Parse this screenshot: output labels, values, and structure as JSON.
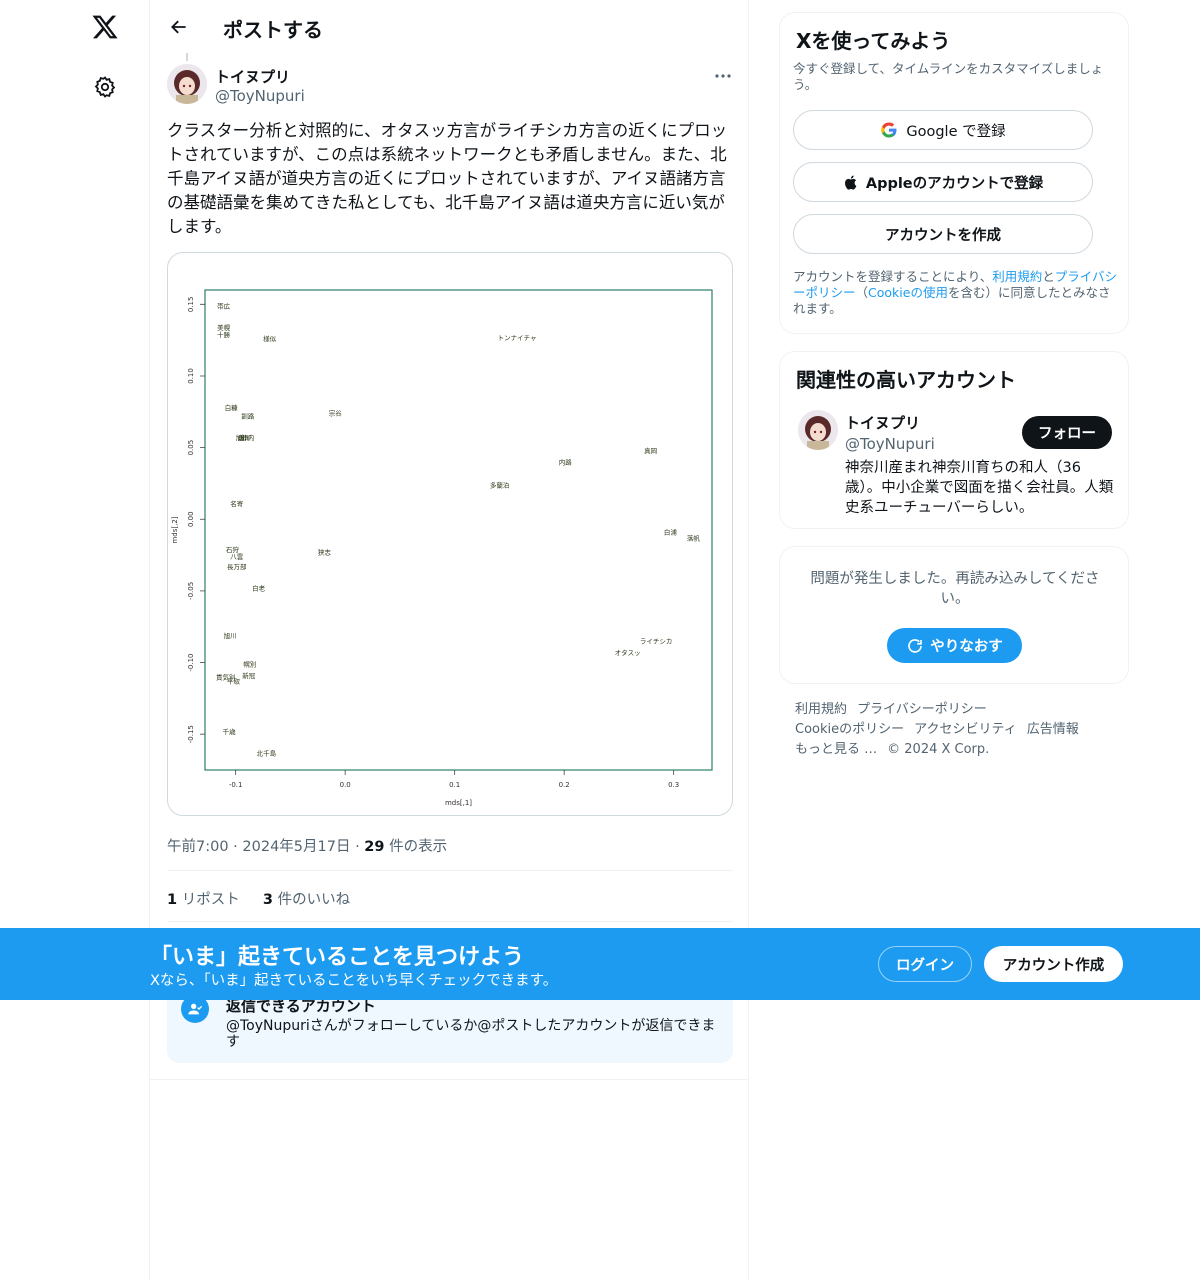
{
  "nav": {
    "logo_icon": "x-logo-icon",
    "settings_icon": "gear-icon"
  },
  "header": {
    "title": "ポストする",
    "back_icon": "arrow-left-icon"
  },
  "post": {
    "author_name": "トイヌプリ",
    "author_handle": "@ToyNupuri",
    "text": "クラスター分析と対照的に、オタスッ方言がライチシカ方言の近くにプロットされていますが、この点は系統ネットワークとも矛盾しません。また、北千島アイヌ語が道央方言の近くにプロットされていますが、アイヌ語諸方言の基礎語彙を集めてきた私としても、北千島アイヌ語は道央方言に近い気がします。",
    "time": "午前7:00",
    "date": "2024年5月17日",
    "view_count": "29",
    "view_label": "件の表示",
    "repost_count": "1",
    "repost_label": "リポスト",
    "like_count": "3",
    "like_label": "件のいいね"
  },
  "reply_restriction": {
    "title": "返信できるアカウント",
    "description": "@ToyNupuriさんがフォローしているか@ポストしたアカウントが返信できます"
  },
  "signup_card": {
    "title": "Xを使ってみよう",
    "subtitle": "今すぐ登録して、タイムラインをカスタマイズしましょう。",
    "google_label": "Google で登録",
    "apple_label": "Appleのアカウントで登録",
    "create_label": "アカウントを作成",
    "terms_prefix": "アカウントを登録することにより、",
    "terms_link": "利用規約",
    "terms_and": "と",
    "privacy_link": "プライバシーポリシー",
    "terms_paren_open": "（",
    "cookie_link": "Cookieの使用",
    "terms_suffix": "を含む）に同意したとみなされます。"
  },
  "related": {
    "title": "関連性の高いアカウント",
    "name": "トイヌプリ",
    "handle": "@ToyNupuri",
    "follow_label": "フォロー",
    "bio": "神奈川産まれ神奈川育ちの和人（36歳）。中小企業で図面を描く会社員。人類史系ユーチューバーらしい。"
  },
  "error_card": {
    "message": "問題が発生しました。再読み込みしてください。",
    "retry_label": "やりなおす"
  },
  "footer": {
    "links": [
      "利用規約",
      "プライバシーポリシー",
      "Cookieのポリシー",
      "アクセシビリティ",
      "広告情報",
      "もっと見る …"
    ],
    "copyright": "© 2024 X Corp."
  },
  "banner": {
    "title": "「いま」起きていることを見つけよう",
    "subtitle": "Xなら、「いま」起きていることをいち早くチェックできます。",
    "login_label": "ログイン",
    "signup_label": "アカウント作成"
  },
  "colors": {
    "accent": "#1d9bf0",
    "text": "#0f1419",
    "secondary": "#536471",
    "border": "#eff3f4",
    "chart_frame": "#2e7d6b",
    "chart_label": "#2d3a1a"
  },
  "chart_data": {
    "type": "scatter",
    "title": "",
    "xlabel": "mds[,1]",
    "ylabel": "mds[,2]",
    "xlim": [
      -0.128,
      0.335
    ],
    "ylim": [
      -0.175,
      0.16
    ],
    "xticks": [
      -0.1,
      0.0,
      0.1,
      0.2,
      0.3
    ],
    "xtick_labels": [
      "-0.1",
      "0.0",
      "0.1",
      "0.2",
      "0.3"
    ],
    "yticks": [
      -0.15,
      -0.1,
      -0.05,
      0.0,
      0.05,
      0.1,
      0.15
    ],
    "ytick_labels": [
      "-0.15",
      "-0.10",
      "-0.05",
      "0.00",
      "0.05",
      "0.10",
      "0.15"
    ],
    "points": [
      {
        "label": "帯広",
        "x": -0.111,
        "y": 0.149
      },
      {
        "label": "美幌",
        "x": -0.111,
        "y": 0.134
      },
      {
        "label": "十勝",
        "x": -0.111,
        "y": 0.129
      },
      {
        "label": "様似",
        "x": -0.069,
        "y": 0.126
      },
      {
        "label": "トンナイチャ",
        "x": 0.157,
        "y": 0.127
      },
      {
        "label": "白糠",
        "x": -0.104,
        "y": 0.078
      },
      {
        "label": "釧路",
        "x": -0.089,
        "y": 0.072
      },
      {
        "label": "宗谷",
        "x": -0.009,
        "y": 0.074
      },
      {
        "label": "旭川",
        "x": -0.094,
        "y": 0.057
      },
      {
        "label": "静内",
        "x": -0.089,
        "y": 0.057
      },
      {
        "label": "鵡川",
        "x": -0.092,
        "y": 0.057
      },
      {
        "label": "真岡",
        "x": 0.279,
        "y": 0.048
      },
      {
        "label": "内路",
        "x": 0.201,
        "y": 0.04
      },
      {
        "label": "多蘭泊",
        "x": 0.141,
        "y": 0.024
      },
      {
        "label": "名寄",
        "x": -0.099,
        "y": 0.011
      },
      {
        "label": "白浦",
        "x": 0.297,
        "y": -0.009
      },
      {
        "label": "落帆",
        "x": 0.318,
        "y": -0.013
      },
      {
        "label": "石狩",
        "x": -0.103,
        "y": -0.021
      },
      {
        "label": "八雲",
        "x": -0.099,
        "y": -0.026
      },
      {
        "label": "長万部",
        "x": -0.099,
        "y": -0.033
      },
      {
        "label": "狭志",
        "x": -0.019,
        "y": -0.023
      },
      {
        "label": "白老",
        "x": -0.079,
        "y": -0.048
      },
      {
        "label": "旭川",
        "x": -0.105,
        "y": -0.081
      },
      {
        "label": "ライチシカ",
        "x": 0.284,
        "y": -0.085
      },
      {
        "label": "オタスッ",
        "x": 0.258,
        "y": -0.093
      },
      {
        "label": "幌別",
        "x": -0.087,
        "y": -0.101
      },
      {
        "label": "新冠",
        "x": -0.088,
        "y": -0.109
      },
      {
        "label": "貫気別",
        "x": -0.109,
        "y": -0.11
      },
      {
        "label": "平取",
        "x": -0.102,
        "y": -0.113
      },
      {
        "label": "千歳",
        "x": -0.106,
        "y": -0.148
      },
      {
        "label": "北千島",
        "x": -0.072,
        "y": -0.163
      }
    ]
  }
}
